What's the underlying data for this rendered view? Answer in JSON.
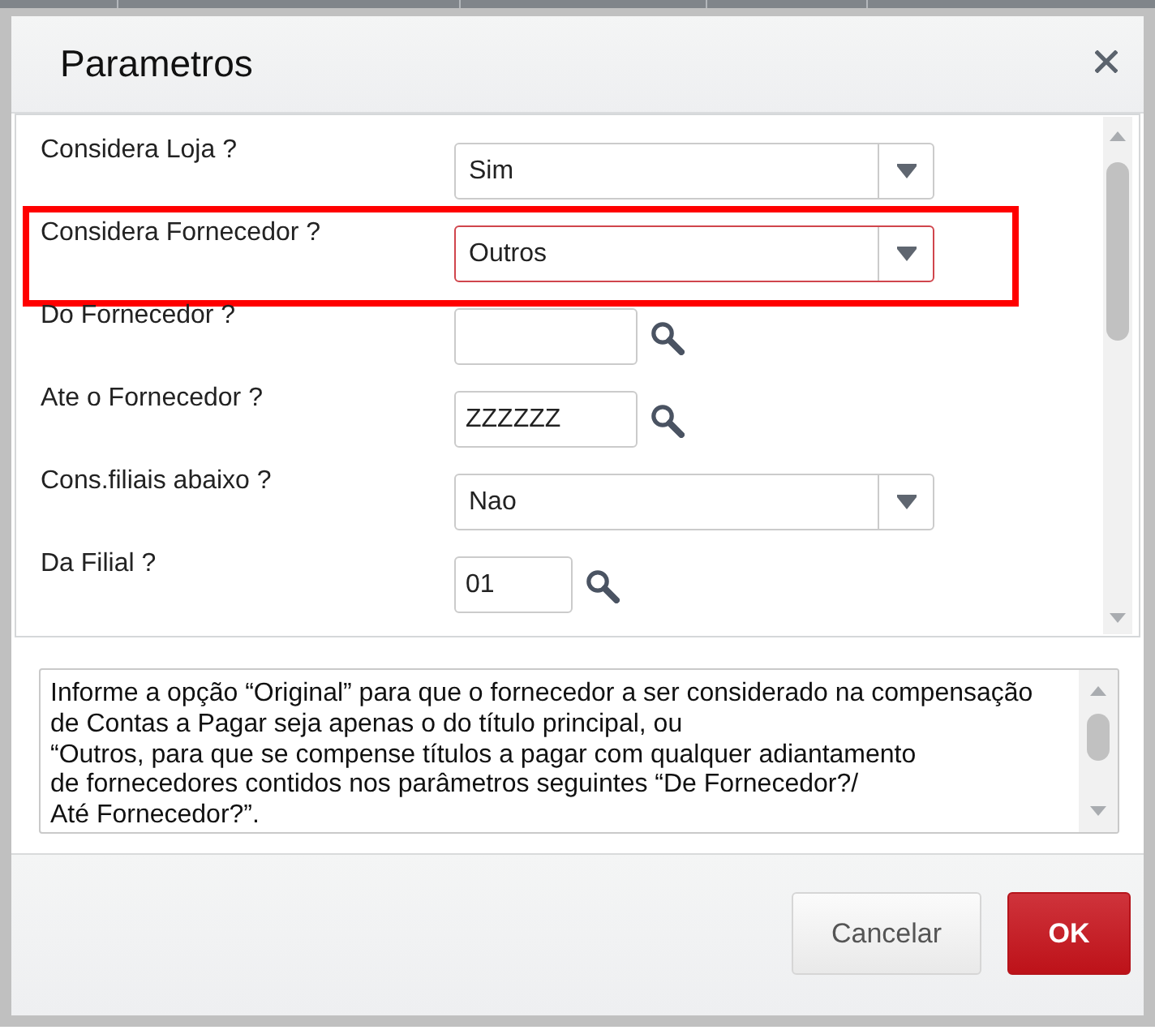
{
  "dialog": {
    "title": "Parametros"
  },
  "parameters": [
    {
      "label": "Considera Loja ?",
      "kind": "select",
      "value": "Sim",
      "focused": false,
      "highlighted": false
    },
    {
      "label": "Considera Fornecedor ?",
      "kind": "select",
      "value": "Outros",
      "focused": true,
      "highlighted": true
    },
    {
      "label": "Do Fornecedor ?",
      "kind": "lookup",
      "focused": false,
      "highlighted": false
    },
    {
      "label": "Ate o Fornecedor ?",
      "kind": "lookup",
      "value": "ZZZZZZ",
      "focused": false,
      "highlighted": false
    },
    {
      "label": "Cons.filiais abaixo ?",
      "kind": "select",
      "value": "Nao",
      "focused": false,
      "highlighted": false
    },
    {
      "label": "Da Filial ?",
      "kind": "shortlookup",
      "value": "01",
      "focused": false,
      "highlighted": false
    }
  ],
  "help_text": "Informe a opção “Original” para que o fornecedor a ser considerado na compensação\nde Contas a Pagar seja apenas o do título principal, ou\n“Outros, para que se compense títulos a pagar com qualquer adiantamento\nde fornecedores contidos nos parâmetros seguintes “De Fornecedor?/\nAté Fornecedor?”.",
  "buttons": [
    {
      "label": "Cancelar",
      "kind": "secondary"
    },
    {
      "label": "OK",
      "kind": "primary"
    }
  ]
}
